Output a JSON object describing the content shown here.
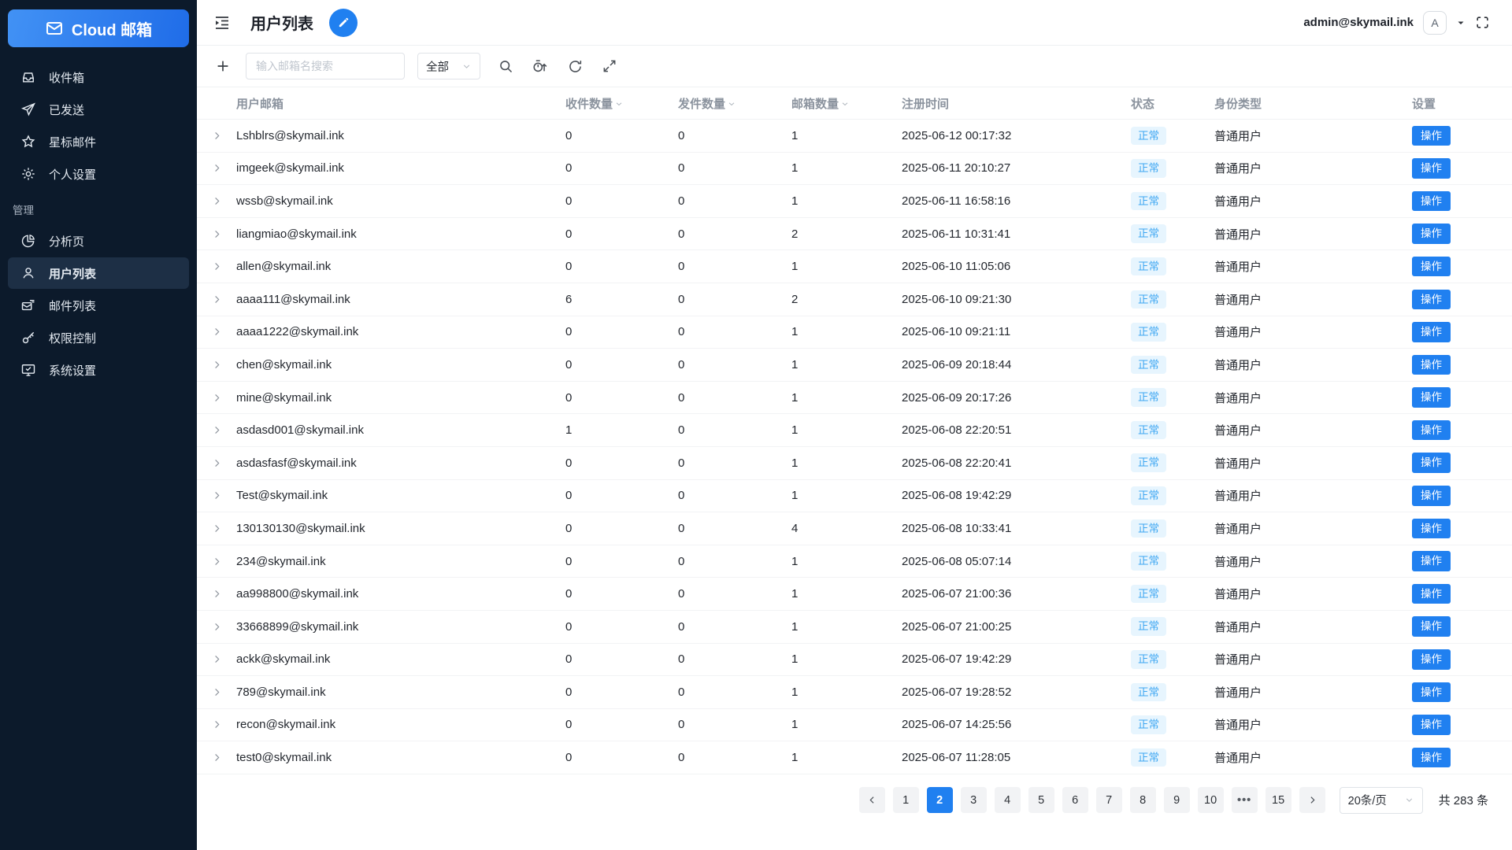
{
  "brand": {
    "name": "Cloud 邮箱"
  },
  "sidebar": {
    "main_items": [
      {
        "label": "收件箱",
        "icon": "inbox"
      },
      {
        "label": "已发送",
        "icon": "send"
      },
      {
        "label": "星标邮件",
        "icon": "star"
      },
      {
        "label": "个人设置",
        "icon": "gear"
      }
    ],
    "section_label": "管理",
    "admin_items": [
      {
        "label": "分析页",
        "icon": "pie"
      },
      {
        "label": "用户列表",
        "icon": "user",
        "active": true
      },
      {
        "label": "邮件列表",
        "icon": "mail-list"
      },
      {
        "label": "权限控制",
        "icon": "key"
      },
      {
        "label": "系统设置",
        "icon": "monitor"
      }
    ]
  },
  "header": {
    "title": "用户列表",
    "account_email": "admin@skymail.ink",
    "avatar_text": "A"
  },
  "toolbar": {
    "search_placeholder": "输入邮箱名搜索",
    "filter_value": "全部"
  },
  "table": {
    "columns": [
      {
        "key": "email",
        "label": "用户邮箱",
        "sortable": false
      },
      {
        "key": "received",
        "label": "收件数量",
        "sortable": true
      },
      {
        "key": "sent",
        "label": "发件数量",
        "sortable": true
      },
      {
        "key": "mailboxes",
        "label": "邮箱数量",
        "sortable": true
      },
      {
        "key": "registered",
        "label": "注册时间",
        "sortable": false
      },
      {
        "key": "status",
        "label": "状态",
        "sortable": false
      },
      {
        "key": "role",
        "label": "身份类型",
        "sortable": false
      },
      {
        "key": "action",
        "label": "设置",
        "sortable": false
      }
    ],
    "rows": [
      {
        "email": "Lshblrs@skymail.ink",
        "received": "0",
        "sent": "0",
        "mailboxes": "1",
        "registered": "2025-06-12 00:17:32",
        "status": "正常",
        "role": "普通用户",
        "action": "操作"
      },
      {
        "email": "imgeek@skymail.ink",
        "received": "0",
        "sent": "0",
        "mailboxes": "1",
        "registered": "2025-06-11 20:10:27",
        "status": "正常",
        "role": "普通用户",
        "action": "操作"
      },
      {
        "email": "wssb@skymail.ink",
        "received": "0",
        "sent": "0",
        "mailboxes": "1",
        "registered": "2025-06-11 16:58:16",
        "status": "正常",
        "role": "普通用户",
        "action": "操作"
      },
      {
        "email": "liangmiao@skymail.ink",
        "received": "0",
        "sent": "0",
        "mailboxes": "2",
        "registered": "2025-06-11 10:31:41",
        "status": "正常",
        "role": "普通用户",
        "action": "操作"
      },
      {
        "email": "allen@skymail.ink",
        "received": "0",
        "sent": "0",
        "mailboxes": "1",
        "registered": "2025-06-10 11:05:06",
        "status": "正常",
        "role": "普通用户",
        "action": "操作"
      },
      {
        "email": "aaaa111@skymail.ink",
        "received": "6",
        "sent": "0",
        "mailboxes": "2",
        "registered": "2025-06-10 09:21:30",
        "status": "正常",
        "role": "普通用户",
        "action": "操作"
      },
      {
        "email": "aaaa1222@skymail.ink",
        "received": "0",
        "sent": "0",
        "mailboxes": "1",
        "registered": "2025-06-10 09:21:11",
        "status": "正常",
        "role": "普通用户",
        "action": "操作"
      },
      {
        "email": "chen@skymail.ink",
        "received": "0",
        "sent": "0",
        "mailboxes": "1",
        "registered": "2025-06-09 20:18:44",
        "status": "正常",
        "role": "普通用户",
        "action": "操作"
      },
      {
        "email": "mine@skymail.ink",
        "received": "0",
        "sent": "0",
        "mailboxes": "1",
        "registered": "2025-06-09 20:17:26",
        "status": "正常",
        "role": "普通用户",
        "action": "操作"
      },
      {
        "email": "asdasd001@skymail.ink",
        "received": "1",
        "sent": "0",
        "mailboxes": "1",
        "registered": "2025-06-08 22:20:51",
        "status": "正常",
        "role": "普通用户",
        "action": "操作"
      },
      {
        "email": "asdasfasf@skymail.ink",
        "received": "0",
        "sent": "0",
        "mailboxes": "1",
        "registered": "2025-06-08 22:20:41",
        "status": "正常",
        "role": "普通用户",
        "action": "操作"
      },
      {
        "email": "Test@skymail.ink",
        "received": "0",
        "sent": "0",
        "mailboxes": "1",
        "registered": "2025-06-08 19:42:29",
        "status": "正常",
        "role": "普通用户",
        "action": "操作"
      },
      {
        "email": "130130130@skymail.ink",
        "received": "0",
        "sent": "0",
        "mailboxes": "4",
        "registered": "2025-06-08 10:33:41",
        "status": "正常",
        "role": "普通用户",
        "action": "操作"
      },
      {
        "email": "234@skymail.ink",
        "received": "0",
        "sent": "0",
        "mailboxes": "1",
        "registered": "2025-06-08 05:07:14",
        "status": "正常",
        "role": "普通用户",
        "action": "操作"
      },
      {
        "email": "aa998800@skymail.ink",
        "received": "0",
        "sent": "0",
        "mailboxes": "1",
        "registered": "2025-06-07 21:00:36",
        "status": "正常",
        "role": "普通用户",
        "action": "操作"
      },
      {
        "email": "33668899@skymail.ink",
        "received": "0",
        "sent": "0",
        "mailboxes": "1",
        "registered": "2025-06-07 21:00:25",
        "status": "正常",
        "role": "普通用户",
        "action": "操作"
      },
      {
        "email": "ackk@skymail.ink",
        "received": "0",
        "sent": "0",
        "mailboxes": "1",
        "registered": "2025-06-07 19:42:29",
        "status": "正常",
        "role": "普通用户",
        "action": "操作"
      },
      {
        "email": "789@skymail.ink",
        "received": "0",
        "sent": "0",
        "mailboxes": "1",
        "registered": "2025-06-07 19:28:52",
        "status": "正常",
        "role": "普通用户",
        "action": "操作"
      },
      {
        "email": "recon@skymail.ink",
        "received": "0",
        "sent": "0",
        "mailboxes": "1",
        "registered": "2025-06-07 14:25:56",
        "status": "正常",
        "role": "普通用户",
        "action": "操作"
      },
      {
        "email": "test0@skymail.ink",
        "received": "0",
        "sent": "0",
        "mailboxes": "1",
        "registered": "2025-06-07 11:28:05",
        "status": "正常",
        "role": "普通用户",
        "action": "操作"
      }
    ]
  },
  "pagination": {
    "pages": [
      "1",
      "2",
      "3",
      "4",
      "5",
      "6",
      "7",
      "8",
      "9",
      "10",
      "...",
      "15"
    ],
    "active_page": "2",
    "page_size": "20条/页",
    "total": "共 283 条"
  },
  "colors": {
    "accent": "#2080f0",
    "sidebar_bg": "#0c1a2b",
    "badge_bg": "#e7f5fe",
    "badge_text": "#3da6f2"
  }
}
